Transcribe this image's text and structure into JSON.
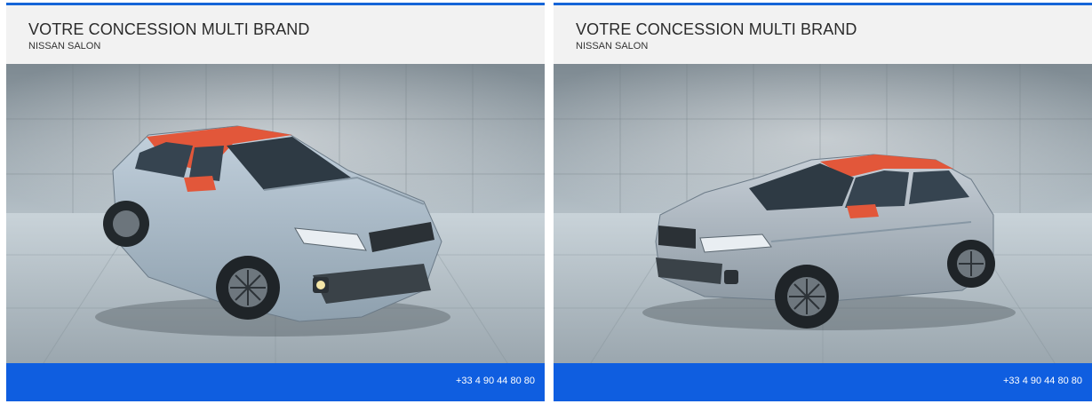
{
  "cards": [
    {
      "title": "VOTRE CONCESSION MULTI BRAND",
      "subtitle": "NISSAN SALON",
      "phone": "+33 4 90 44 80 80",
      "photo_view": "front-three-quarter"
    },
    {
      "title": "VOTRE CONCESSION MULTI BRAND",
      "subtitle": "NISSAN SALON",
      "phone": "+33 4 90 44 80 80",
      "photo_view": "rear-three-quarter"
    }
  ],
  "colors": {
    "accent_blue": "#0f5ee0",
    "header_bg": "#f2f2f2",
    "car_body": "#a9b8c6",
    "car_roof_accent": "#e2573a"
  }
}
